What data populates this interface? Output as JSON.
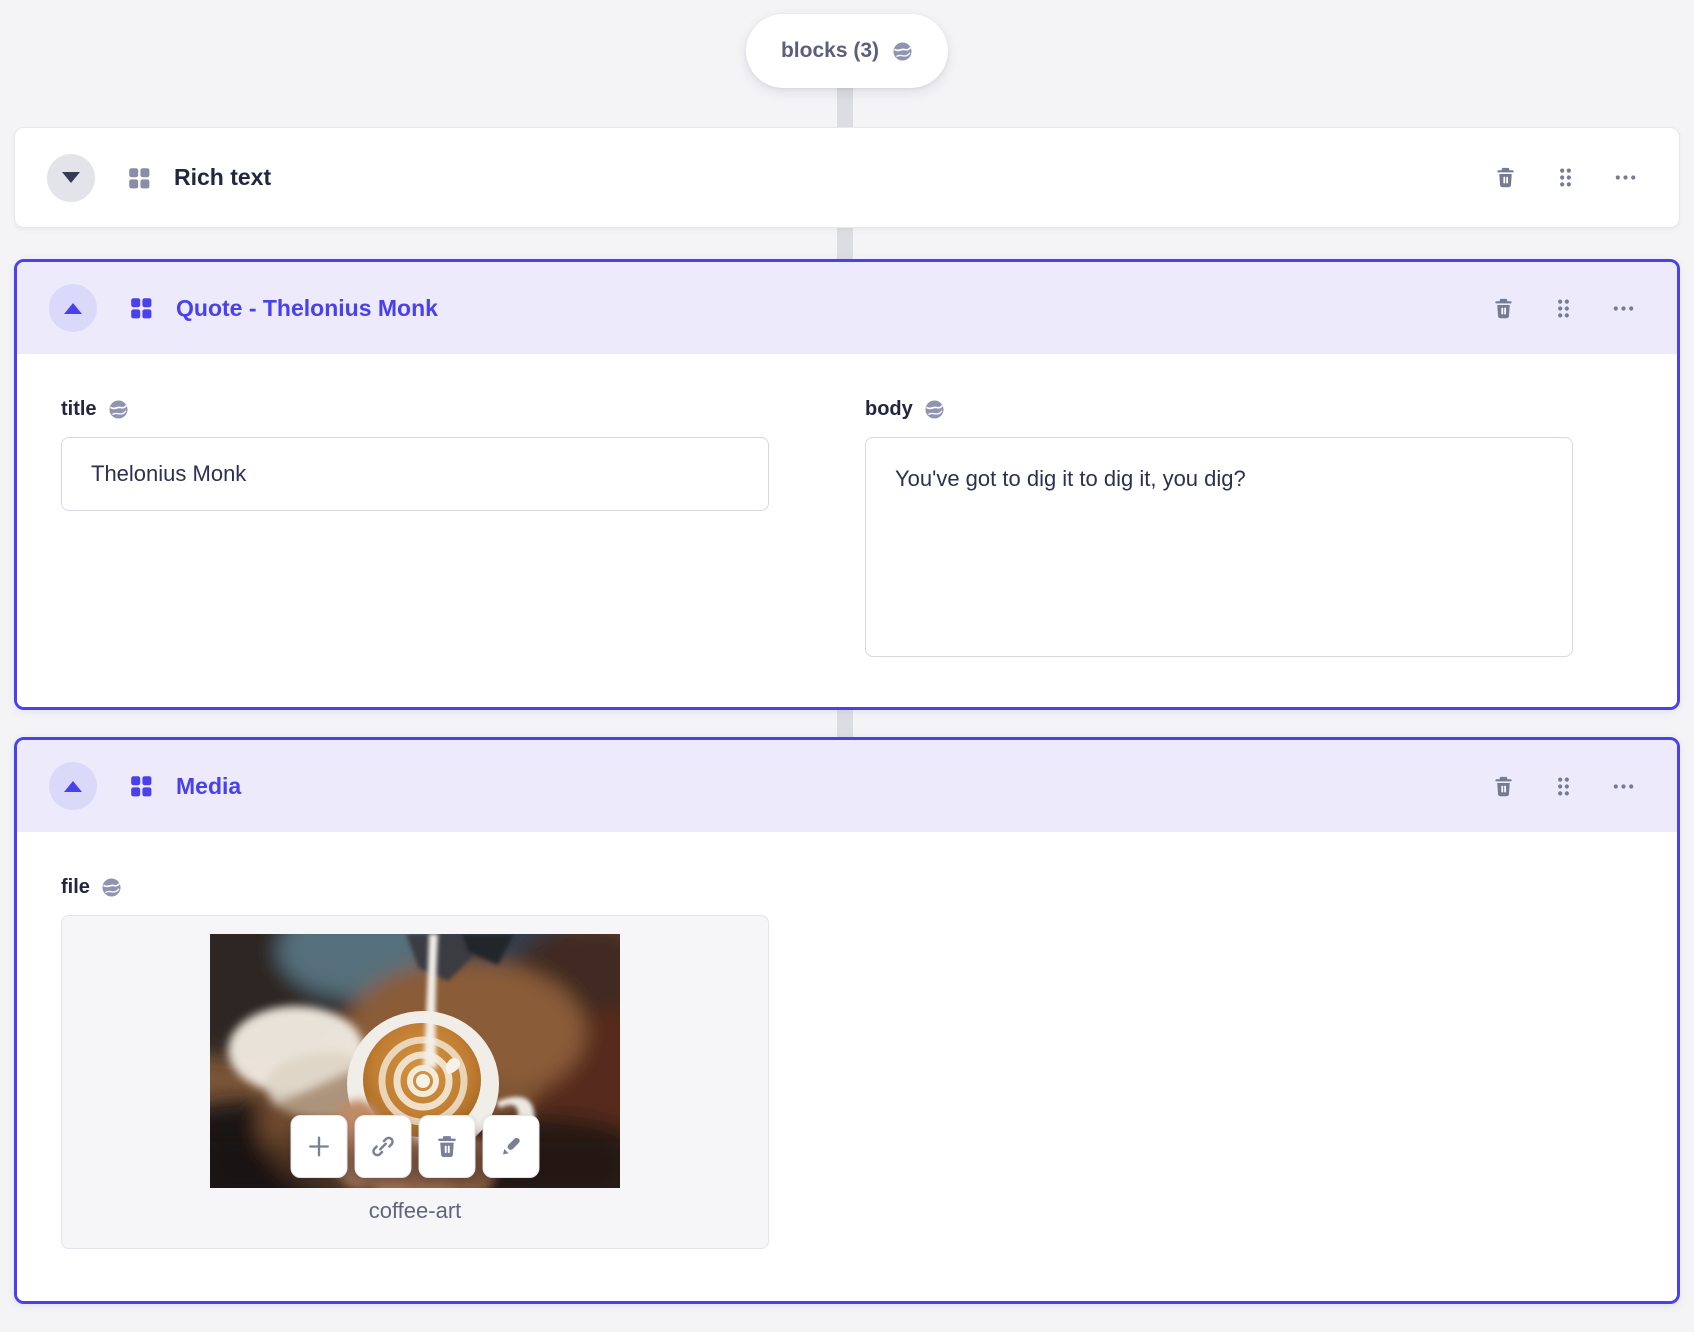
{
  "colors": {
    "accent": "#4a41ec",
    "accent_header_bg": "#eceafb",
    "page_bg": "#f4f4f6",
    "icon_gray": "#767a93",
    "connector": "#dcdde2"
  },
  "pill": {
    "label": "blocks (3)",
    "icon": "globe-icon"
  },
  "blocks": [
    {
      "name": "Rich text",
      "state": "collapsed"
    },
    {
      "name": "Quote - Thelonius Monk",
      "state": "expanded",
      "fields": {
        "title": {
          "label": "title",
          "value": "Thelonius Monk"
        },
        "body": {
          "label": "body",
          "value": "You've got to dig it to dig it, you dig?"
        }
      }
    },
    {
      "name": "Media",
      "state": "expanded",
      "fields": {
        "file": {
          "label": "file",
          "filename": "coffee-art",
          "actions": [
            "plus-icon",
            "link-icon",
            "trash-icon",
            "edit-icon"
          ]
        }
      }
    }
  ]
}
